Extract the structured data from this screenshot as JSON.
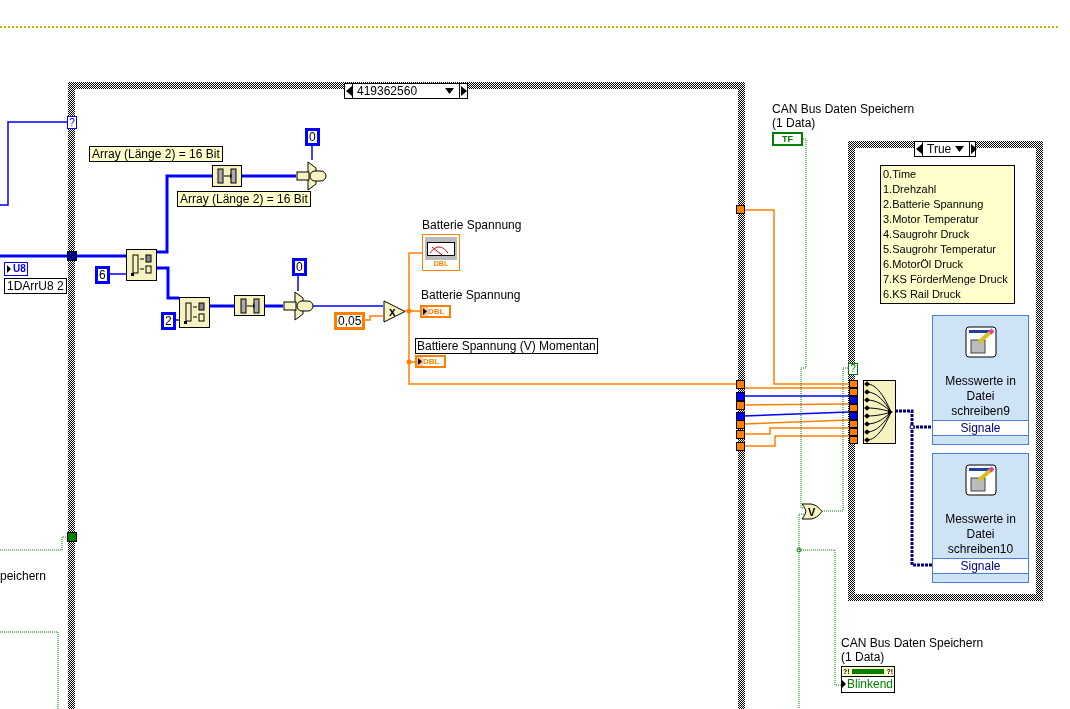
{
  "case_structure": {
    "selector": "419362560",
    "left_tunnel": "?"
  },
  "inner_case": {
    "selector": "True",
    "condition_tunnel": "?"
  },
  "comments": [
    "Array (Länge 2) = 16 Bit",
    "Array (Länge 2) = 16 Bit"
  ],
  "constants": [
    {
      "value": "0",
      "kind": "integer"
    },
    {
      "value": "6",
      "kind": "integer"
    },
    {
      "value": "2",
      "kind": "integer"
    },
    {
      "value": "0",
      "kind": "integer"
    },
    {
      "value": "0,05",
      "kind": "double"
    }
  ],
  "array_control": {
    "type": "U8",
    "label": "1DArrU8 2"
  },
  "cut_label": "peichern",
  "multiply": {
    "symbol": "x"
  },
  "or_gate": {
    "symbol": "V"
  },
  "indicators": [
    {
      "label": "Batterie Spannung",
      "kind": "chart",
      "type": "DBL"
    },
    {
      "label": "Batterie Spannung",
      "kind": "numeric",
      "type": "DBL"
    },
    {
      "label": "Battiere Spannung (V) Momentan",
      "kind": "numeric_boxed",
      "type": "DBL"
    }
  ],
  "boolean_control": {
    "label": [
      "CAN Bus Daten Speichern",
      "(1 Data)"
    ],
    "type": "TF"
  },
  "led": {
    "label": [
      "CAN Bus Daten Speichern",
      "(1 Data)"
    ],
    "marks": [
      "?!",
      "?!"
    ],
    "text": "Blinkend"
  },
  "legend": [
    "0.Time",
    "1.Drehzahl",
    "2.Batterie Spannung",
    "3.Motor Temperatur",
    "4.Saugrohr Druck",
    "5.Saugrohr Temperatur",
    "6.MotorÖl Druck",
    "7.KS FörderMenge Druck",
    "6.KS Rail Druck"
  ],
  "express_vis": [
    {
      "title": "Messwerte in Datei schreiben9",
      "input": "Signale"
    },
    {
      "title": "Messwerte in Datei schreiben10",
      "input": "Signale"
    }
  ],
  "output_tunnels": [
    {
      "kind": "double"
    },
    {
      "kind": "double"
    },
    {
      "kind": "integer"
    },
    {
      "kind": "double"
    },
    {
      "kind": "integer"
    },
    {
      "kind": "double"
    },
    {
      "kind": "double"
    },
    {
      "kind": "double"
    }
  ],
  "inner_tunnels": [
    {
      "kind": "double"
    },
    {
      "kind": "double"
    },
    {
      "kind": "integer"
    },
    {
      "kind": "double"
    },
    {
      "kind": "integer"
    },
    {
      "kind": "double"
    },
    {
      "kind": "double"
    },
    {
      "kind": "double"
    }
  ]
}
